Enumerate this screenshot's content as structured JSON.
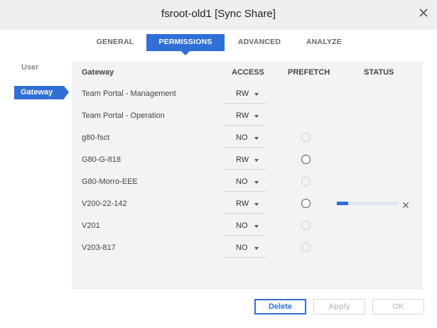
{
  "dialog": {
    "title": "fsroot-old1 [Sync Share]"
  },
  "tabs": [
    {
      "label": "GENERAL"
    },
    {
      "label": "PERMISSIONS"
    },
    {
      "label": "ADVANCED"
    },
    {
      "label": "ANALYZE"
    }
  ],
  "active_tab": "PERMISSIONS",
  "sidebar": {
    "items": [
      {
        "label": "User"
      },
      {
        "label": "Gateway"
      }
    ],
    "active": "Gateway"
  },
  "table": {
    "headers": {
      "gateway": "Gateway",
      "access": "ACCESS",
      "prefetch": "PREFETCH",
      "status": "STATUS"
    },
    "rows": [
      {
        "name": "Team Portal - Management",
        "access": "RW",
        "prefetch": "none"
      },
      {
        "name": "Team Portal - Operation",
        "access": "RW",
        "prefetch": "none"
      },
      {
        "name": "g80-fsct",
        "access": "NO",
        "prefetch": "disabled"
      },
      {
        "name": "G80-G-818",
        "access": "RW",
        "prefetch": "enabled"
      },
      {
        "name": "G80-Morro-EEE",
        "access": "NO",
        "prefetch": "disabled"
      },
      {
        "name": "V200-22-142",
        "access": "RW",
        "prefetch": "enabled",
        "status_progress": 0.18
      },
      {
        "name": "V201",
        "access": "NO",
        "prefetch": "disabled"
      },
      {
        "name": "V203-817",
        "access": "NO",
        "prefetch": "disabled"
      }
    ]
  },
  "buttons": {
    "delete": "Delete",
    "apply": "Apply",
    "ok": "OK"
  },
  "colors": {
    "accent": "#2f6fd6",
    "header_bg": "#efefef",
    "panel_bg": "#f3f3f3"
  },
  "icons": {
    "close": "close-icon",
    "dropdown": "chevron-down-icon",
    "cancel": "close-icon"
  }
}
